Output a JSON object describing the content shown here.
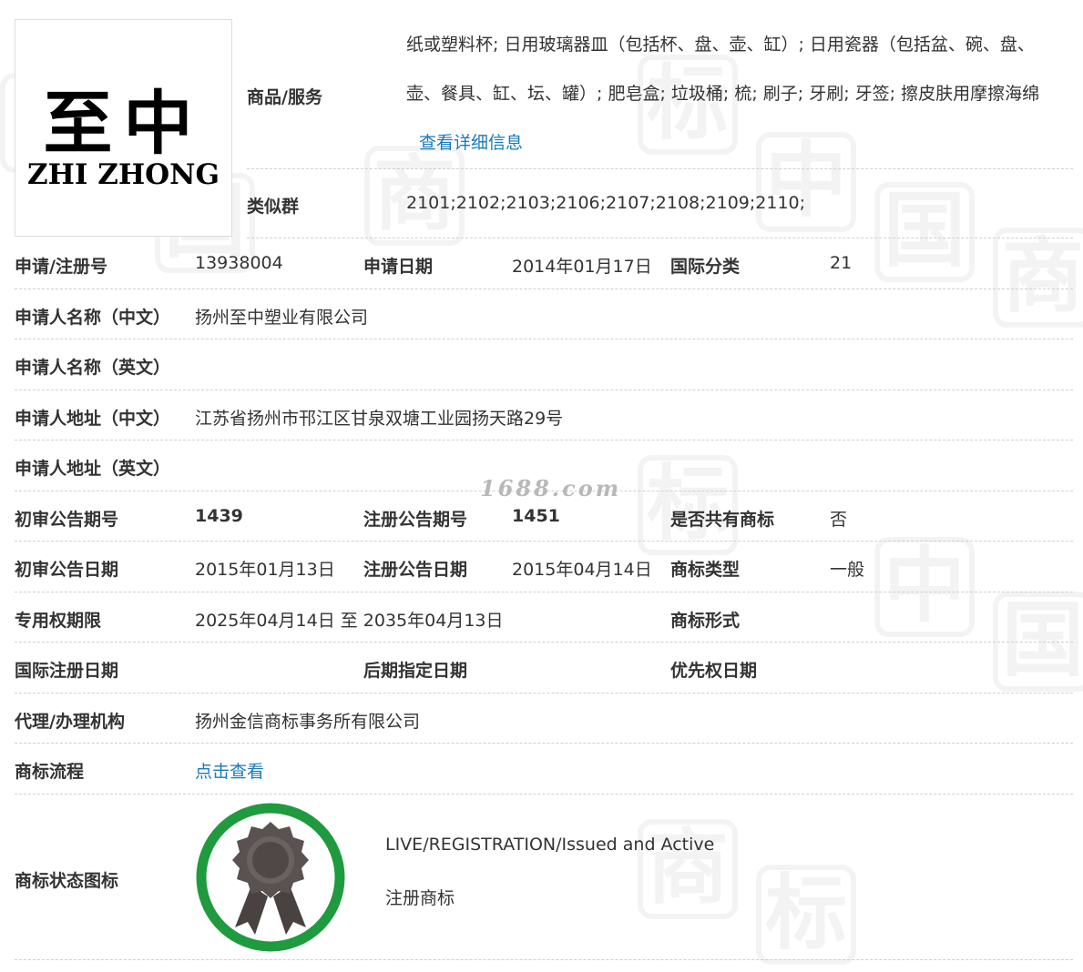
{
  "logo": {
    "chinese_text": "至中",
    "english_text": "ZHI ZHONG"
  },
  "goods": {
    "label": "商品/服务",
    "value": "纸或塑料杯; 日用玻璃器皿（包括杯、盘、壶、缸）; 日用瓷器（包括盆、碗、盘、壶、餐具、缸、坛、罐）; 肥皂盒; 垃圾桶; 梳; 刷子; 牙刷; 牙签; 擦皮肤用摩擦海绵",
    "detail_link": "查看详细信息"
  },
  "similar_group": {
    "label": "类似群",
    "value": "2101;2102;2103;2106;2107;2108;2109;2110;"
  },
  "rows": {
    "reg_no_label": "申请/注册号",
    "reg_no": "13938004",
    "app_date_label": "申请日期",
    "app_date": "2014年01月17日",
    "intl_class_label": "国际分类",
    "intl_class": "21",
    "applicant_cn_label": "申请人名称（中文）",
    "applicant_cn": "扬州至中塑业有限公司",
    "applicant_en_label": "申请人名称（英文）",
    "applicant_en": "",
    "address_cn_label": "申请人地址（中文）",
    "address_cn": "江苏省扬州市邗江区甘泉双塘工业园扬天路29号",
    "address_en_label": "申请人地址（英文）",
    "address_en": "",
    "prelim_no_label": "初审公告期号",
    "prelim_no": "1439",
    "reg_pub_no_label": "注册公告期号",
    "reg_pub_no": "1451",
    "shared_label": "是否共有商标",
    "shared": "否",
    "prelim_date_label": "初审公告日期",
    "prelim_date": "2015年01月13日",
    "reg_pub_date_label": "注册公告日期",
    "reg_pub_date": "2015年04月14日",
    "tm_type_label": "商标类型",
    "tm_type": "一般",
    "term_label": "专用权期限",
    "term": "2025年04月14日 至 2035年04月13日",
    "tm_form_label": "商标形式",
    "tm_form": "",
    "intl_reg_date_label": "国际注册日期",
    "intl_reg_date": "",
    "later_date_label": "后期指定日期",
    "later_date": "",
    "priority_label": "优先权日期",
    "priority": "",
    "agent_label": "代理/办理机构",
    "agent": "扬州金信商标事务所有限公司",
    "process_label": "商标流程",
    "process_link": "点击查看",
    "status_label": "商标状态图标",
    "status_en": "LIVE/REGISTRATION/Issued and Active",
    "status_cn": "注册商标"
  },
  "watermark_site": "1688.com",
  "watermark_chars": [
    "中",
    "国",
    "商",
    "标",
    "中",
    "国",
    "商",
    "标",
    "中",
    "国",
    "商",
    "标"
  ],
  "colors": {
    "link": "#1a7ab8",
    "badge_ring": "#1f9a3e",
    "badge_rosette": "#5a5250"
  }
}
